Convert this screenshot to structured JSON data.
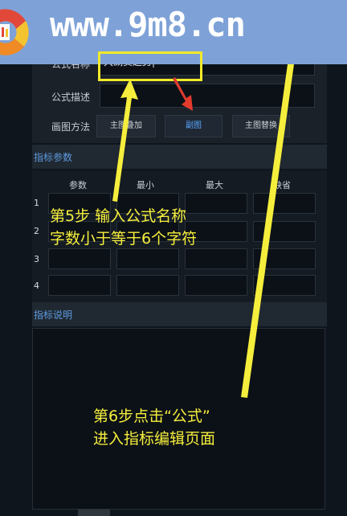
{
  "banner": {
    "site": "www.9m8.cn"
  },
  "formula": {
    "name_label": "公式名称",
    "name_value": "大涮贯趋势|",
    "desc_label": "公式描述",
    "draw_label": "画图方法",
    "draw_options": [
      "主图叠加",
      "副图",
      "主图替换"
    ]
  },
  "params_section": {
    "title": "指标参数",
    "headers": [
      "参数",
      "最小",
      "最大",
      "缺省"
    ],
    "rows": [
      "1",
      "2",
      "3",
      "4"
    ]
  },
  "desc_section": {
    "title": "指标说明"
  },
  "annotations": {
    "step5_line1": "第5步  输入公式名称",
    "step5_line2": "字数小于等于6个字符",
    "step6_line1": "第6步点击“公式”",
    "step6_line2": "进入指标编辑页面"
  },
  "colors": {
    "annotation": "#f5ee3c",
    "arrow_red": "#e23b2e",
    "section_title": "#5d9be0",
    "banner": "#7ea2d7"
  }
}
